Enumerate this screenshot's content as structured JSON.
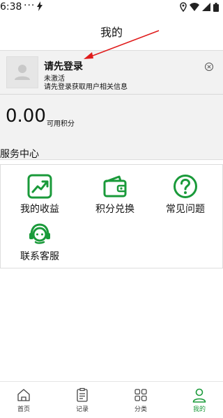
{
  "status_bar": {
    "time": "6:38",
    "dots": "···"
  },
  "header": {
    "title": "我的"
  },
  "profile": {
    "title": "请先登录",
    "status": "未激活",
    "hint": "请先登录获取用户相关信息",
    "points_value": "0.00",
    "points_label": "可用积分"
  },
  "services": {
    "section_title": "服务中心",
    "items": [
      {
        "label": "我的收益",
        "icon": "earnings-chart-icon"
      },
      {
        "label": "积分兑换",
        "icon": "wallet-icon"
      },
      {
        "label": "常见问题",
        "icon": "question-icon"
      },
      {
        "label": "联系客服",
        "icon": "headset-icon"
      }
    ]
  },
  "tabs": [
    {
      "label": "首页",
      "icon": "home-icon",
      "active": false
    },
    {
      "label": "记录",
      "icon": "clipboard-icon",
      "active": false
    },
    {
      "label": "分类",
      "icon": "grid-icon",
      "active": false
    },
    {
      "label": "我的",
      "icon": "user-icon",
      "active": true
    }
  ],
  "colors": {
    "accent": "#1a9a3a",
    "arrow": "#e01b1b",
    "card_bg": "#f2f2f2"
  }
}
